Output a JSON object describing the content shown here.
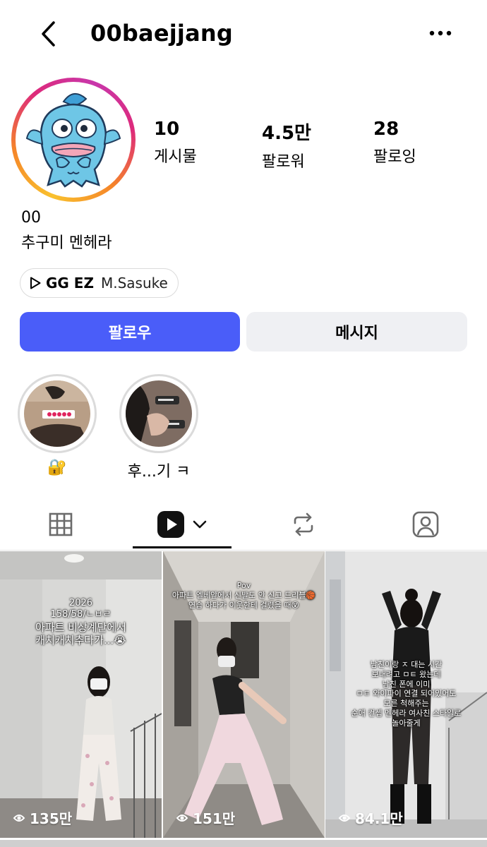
{
  "header": {
    "username": "00baejjang"
  },
  "profile": {
    "stats": [
      {
        "value": "10",
        "label": "게시물"
      },
      {
        "value": "4.5만",
        "label": "팔로워"
      },
      {
        "value": "28",
        "label": "팔로잉"
      }
    ],
    "display_name": "00",
    "bio": "추구미 멘헤라",
    "music": {
      "song": "GG EZ",
      "artist": "M.Sasuke"
    }
  },
  "actions": {
    "follow_label": "팔로우",
    "message_label": "메시지",
    "follow_color": "#4a5df9"
  },
  "highlights": [
    {
      "label": "🔐"
    },
    {
      "label": "후...기 ㅋ"
    }
  ],
  "tabs": [
    {
      "icon": "grid-icon"
    },
    {
      "icon": "reels-icon",
      "active": true
    },
    {
      "icon": "repost-icon"
    },
    {
      "icon": "tagged-icon"
    }
  ],
  "reels": [
    {
      "views": "135만",
      "caption": [
        "2026",
        "158/58/ㄴㅂㄹ",
        "아파트 비상계단에서",
        "캐치캐치추다가...😭"
      ]
    },
    {
      "views": "151만",
      "caption": [
        "Pov",
        "아파트 엘베앞에서 신발도 안 신고 드리블🏀",
        "연습 하다가 이웃한테 걸렸을 때😵"
      ]
    },
    {
      "views": "84.1만",
      "caption": [
        "남친이랑 ㅈ 대는 시간",
        "보내려고 ㅁㅌ 왔는데",
        "남친 폰에 이미",
        "ㅁㅌ 와이파이 연결 되어있어도",
        "모른 척해주는",
        "순애 컨셉 멘헤라 여사친 스타일로",
        "놀아줄게"
      ]
    }
  ]
}
